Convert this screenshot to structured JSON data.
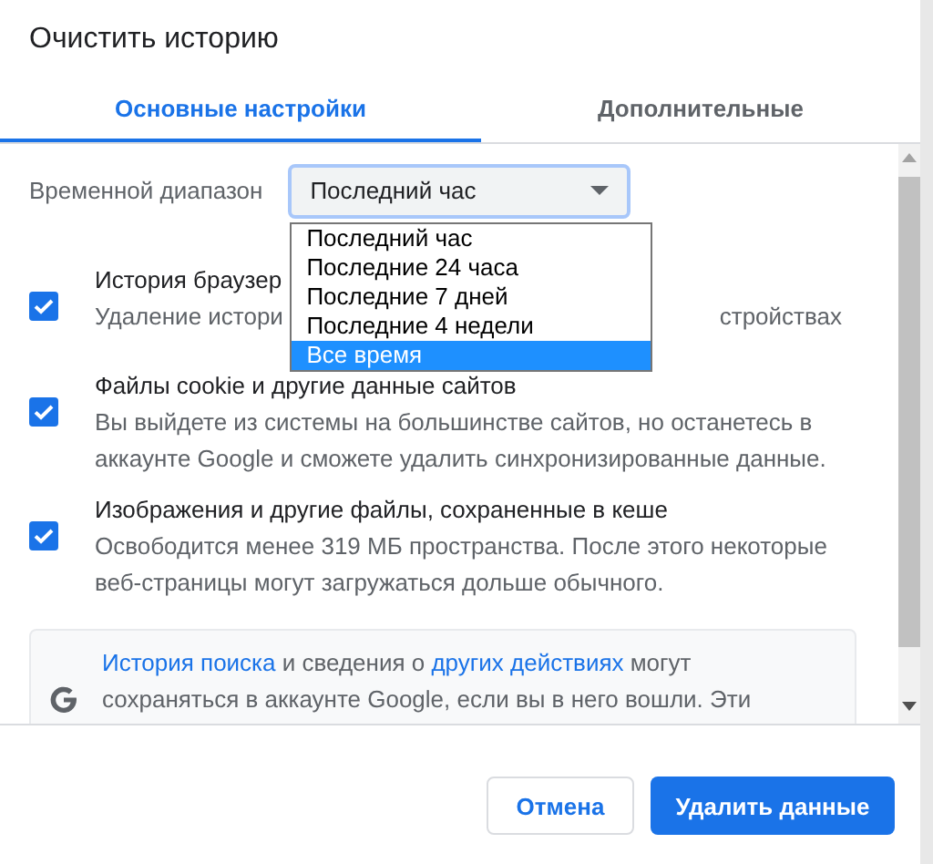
{
  "dialog": {
    "title": "Очистить историю"
  },
  "tabs": [
    {
      "label": "Основные настройки",
      "selected": true
    },
    {
      "label": "Дополнительные",
      "selected": false
    }
  ],
  "time_range": {
    "label": "Временной диапазон",
    "value": "Последний час",
    "expanded": true,
    "options": [
      {
        "label": "Последний час",
        "highlighted": false
      },
      {
        "label": "Последние 24 часа",
        "highlighted": false
      },
      {
        "label": "Последние 7 дней",
        "highlighted": false
      },
      {
        "label": "Последние 4 недели",
        "highlighted": false
      },
      {
        "label": "Все время",
        "highlighted": true
      }
    ]
  },
  "items": [
    {
      "title": "История браузер",
      "description": [
        "Удаление истори",
        "стройствах"
      ],
      "checked": true
    },
    {
      "title": "Файлы cookie и другие данные сайтов",
      "description": [
        "Вы выйдете из системы на большинстве сайтов, но останетесь в аккаунте Google и сможете удалить синхронизированные данные."
      ],
      "checked": true
    },
    {
      "title": "Изображения и другие файлы, сохраненные в кеше",
      "description": [
        "Освободится менее 319 МБ пространства. После этого некоторые веб-страницы могут загружаться дольше обычного."
      ],
      "checked": true
    }
  ],
  "info": {
    "parts": [
      {
        "kind": "link",
        "text": "История поиска"
      },
      {
        "kind": "text",
        "text": " и сведения о "
      },
      {
        "kind": "link",
        "text": "других действиях"
      },
      {
        "kind": "text",
        "text": " могут сохраняться в аккаунте Google, если вы в него вошли. Эти"
      }
    ]
  },
  "buttons": [
    {
      "label": "Отмена",
      "kind": "secondary"
    },
    {
      "label": "Удалить данные",
      "kind": "primary"
    }
  ]
}
